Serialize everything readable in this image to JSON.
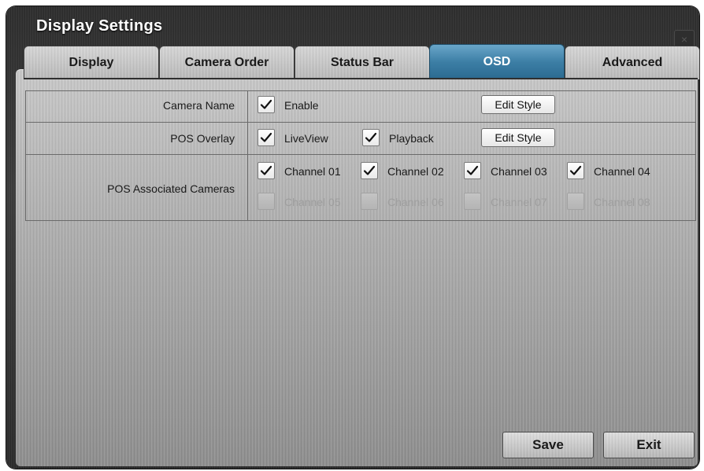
{
  "window": {
    "title": "Display Settings",
    "close_glyph": "×"
  },
  "tabs": [
    {
      "label": "Display",
      "active": false
    },
    {
      "label": "Camera Order",
      "active": false
    },
    {
      "label": "Status Bar",
      "active": false
    },
    {
      "label": "OSD",
      "active": true
    },
    {
      "label": "Advanced",
      "active": false
    }
  ],
  "rows": {
    "camera_name": {
      "label": "Camera Name",
      "enable": {
        "label": "Enable",
        "checked": true
      },
      "edit_style_label": "Edit Style"
    },
    "pos_overlay": {
      "label": "POS Overlay",
      "liveview": {
        "label": "LiveView",
        "checked": true
      },
      "playback": {
        "label": "Playback",
        "checked": true
      },
      "edit_style_label": "Edit Style"
    },
    "pos_associated": {
      "label": "POS Associated Cameras",
      "channels": [
        {
          "label": "Channel 01",
          "checked": true,
          "enabled": true
        },
        {
          "label": "Channel 02",
          "checked": true,
          "enabled": true
        },
        {
          "label": "Channel 03",
          "checked": true,
          "enabled": true
        },
        {
          "label": "Channel 04",
          "checked": true,
          "enabled": true
        },
        {
          "label": "Channel 05",
          "checked": false,
          "enabled": false
        },
        {
          "label": "Channel 06",
          "checked": false,
          "enabled": false
        },
        {
          "label": "Channel 07",
          "checked": false,
          "enabled": false
        },
        {
          "label": "Channel 08",
          "checked": false,
          "enabled": false
        }
      ]
    }
  },
  "footer": {
    "save_label": "Save",
    "exit_label": "Exit"
  },
  "colors": {
    "active_tab": "#3c7ea5",
    "window_bg": "#2c2c2c",
    "panel_bg": "#b2b2b2",
    "disabled_text": "#9e9e9e"
  },
  "icons": {
    "checkbox_check": "check-icon",
    "close": "close-icon"
  }
}
